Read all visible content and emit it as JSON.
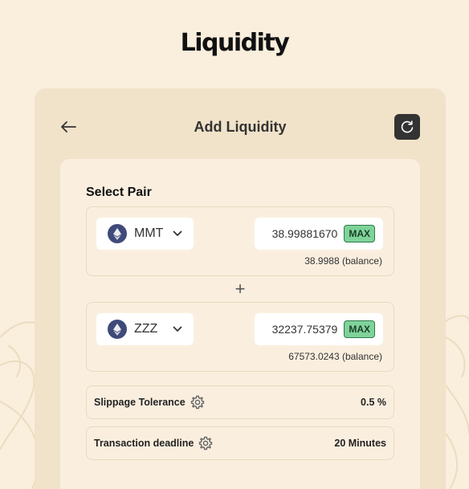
{
  "page": {
    "title": "Liquidity"
  },
  "panel": {
    "title": "Add Liquidity"
  },
  "icons": {
    "back": "arrow-left-icon",
    "refresh": "refresh-icon",
    "token": "ethereum-icon",
    "chevron": "chevron-down-icon",
    "plus": "plus-icon",
    "gear": "gear-icon"
  },
  "pair": {
    "label": "Select Pair",
    "token_a": {
      "symbol": "MMT",
      "amount": "38.99881670",
      "max_label": "MAX",
      "balance": "38.9988 (balance)"
    },
    "separator": "+",
    "token_b": {
      "symbol": "ZZZ",
      "amount": "32237.75379",
      "max_label": "MAX",
      "balance": "67573.0243 (balance)"
    }
  },
  "settings": {
    "slippage": {
      "label": "Slippage Tolerance",
      "value": "0.5 %"
    },
    "deadline": {
      "label": "Transaction deadline",
      "value": "20 Minutes"
    }
  },
  "colors": {
    "background": "#faeedd",
    "panel": "#f1e3c9",
    "max_button": "#7ed39a",
    "refresh_button": "#333333",
    "token_icon": "#3f4a7a"
  }
}
